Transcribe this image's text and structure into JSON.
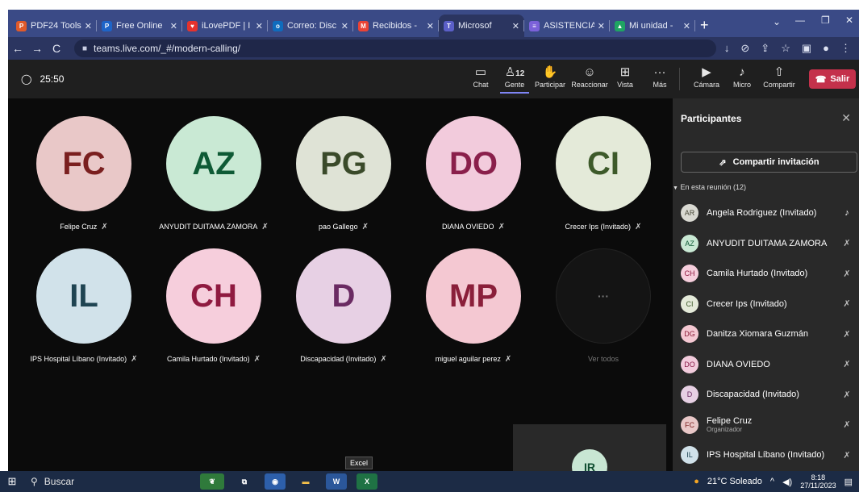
{
  "browser": {
    "tabs": [
      {
        "label": "PDF24 Tools",
        "fav": "P",
        "color": "#e05a2a"
      },
      {
        "label": "Free Online",
        "fav": "P",
        "color": "#1e64c8"
      },
      {
        "label": "iLovePDF | I",
        "fav": "♥",
        "color": "#e5322d"
      },
      {
        "label": "Correo: Disc",
        "fav": "o",
        "color": "#0f6cbd"
      },
      {
        "label": "Recibidos - ",
        "fav": "M",
        "color": "#ea4335"
      },
      {
        "label": "Microsof",
        "fav": "T",
        "color": "#5b5fc7"
      },
      {
        "label": "ASISTENCIA",
        "fav": "≡",
        "color": "#7b61d9"
      },
      {
        "label": "Mi unidad - ",
        "fav": "▲",
        "color": "#1fa463"
      }
    ],
    "url": "teams.live.com/_#/modern-calling/"
  },
  "meeting": {
    "timer": "25:50",
    "controls": {
      "chat": "Chat",
      "people": "Gente",
      "people_count": "12",
      "raise": "Participar",
      "react": "Reaccionar",
      "view": "Vista",
      "more": "Más",
      "camera": "Cámara",
      "mic": "Micro",
      "share": "Compartir",
      "leave": "Salir"
    }
  },
  "grid": {
    "tiles": [
      {
        "initials": "FC",
        "name": "Felipe Cruz",
        "bg": "#e9c8c8",
        "fg": "#7a1f1f"
      },
      {
        "initials": "AZ",
        "name": "ANYUDIT DUITAMA ZAMORA",
        "bg": "#c9e9d4",
        "fg": "#0e5a35"
      },
      {
        "initials": "PG",
        "name": "pao Gallego",
        "bg": "#dfe3d6",
        "fg": "#3a4a2a"
      },
      {
        "initials": "DO",
        "name": "DIANA OVIEDO",
        "bg": "#f2cbdc",
        "fg": "#8a1f4b"
      },
      {
        "initials": "CI",
        "name": "Crecer Ips (Invitado)",
        "bg": "#e4ead9",
        "fg": "#3d5a2a"
      },
      {
        "initials": "IL",
        "name": "IPS Hospital Líbano (Invitado)",
        "bg": "#d1e2ea",
        "fg": "#1f4452"
      },
      {
        "initials": "CH",
        "name": "Camila Hurtado (Invitado)",
        "bg": "#f6cedc",
        "fg": "#8f1a40"
      },
      {
        "initials": "D",
        "name": "Discapacidad (Invitado)",
        "bg": "#e7d0e4",
        "fg": "#6a2a62"
      },
      {
        "initials": "MP",
        "name": "miguel aguilar perez",
        "bg": "#f4c8d2",
        "fg": "#8a1f3a"
      }
    ],
    "more_label": "Ver todos",
    "more_dots": "···",
    "self_initials": "IR"
  },
  "panel": {
    "title": "Participantes",
    "invite": "Compartir invitación",
    "section": "En esta reunión (12)",
    "people": [
      {
        "initials": "AR",
        "name": "Angela Rodriguez (Invitado)",
        "sub": "",
        "bg": "#d9d9d2",
        "fg": "#4a4a3a",
        "mic": "on"
      },
      {
        "initials": "AZ",
        "name": "ANYUDIT DUITAMA ZAMORA",
        "sub": "",
        "bg": "#c9e9d4",
        "fg": "#0e5a35",
        "mic": "off"
      },
      {
        "initials": "CH",
        "name": "Camila Hurtado (Invitado)",
        "sub": "",
        "bg": "#f6cedc",
        "fg": "#8f1a40",
        "mic": "off"
      },
      {
        "initials": "CI",
        "name": "Crecer Ips (Invitado)",
        "sub": "",
        "bg": "#e4ead9",
        "fg": "#3d5a2a",
        "mic": "off"
      },
      {
        "initials": "DG",
        "name": "Danitza Xiomara Guzmán",
        "sub": "",
        "bg": "#f4c8d2",
        "fg": "#8a1f3a",
        "mic": "off"
      },
      {
        "initials": "DO",
        "name": "DIANA OVIEDO",
        "sub": "",
        "bg": "#f2cbdc",
        "fg": "#8a1f4b",
        "mic": "off"
      },
      {
        "initials": "D",
        "name": "Discapacidad (Invitado)",
        "sub": "",
        "bg": "#e7d0e4",
        "fg": "#6a2a62",
        "mic": "off"
      },
      {
        "initials": "FC",
        "name": "Felipe Cruz",
        "sub": "Organizador",
        "bg": "#e9c8c8",
        "fg": "#7a1f1f",
        "mic": "off"
      },
      {
        "initials": "IL",
        "name": "IPS Hospital Líbano (Invitado)",
        "sub": "",
        "bg": "#d1e2ea",
        "fg": "#1f4452",
        "mic": "off"
      }
    ]
  },
  "taskbar": {
    "search": "Buscar",
    "tooltip": "Excel",
    "weather": "21°C Soleado",
    "time": "8:18",
    "date": "27/11/2023"
  }
}
